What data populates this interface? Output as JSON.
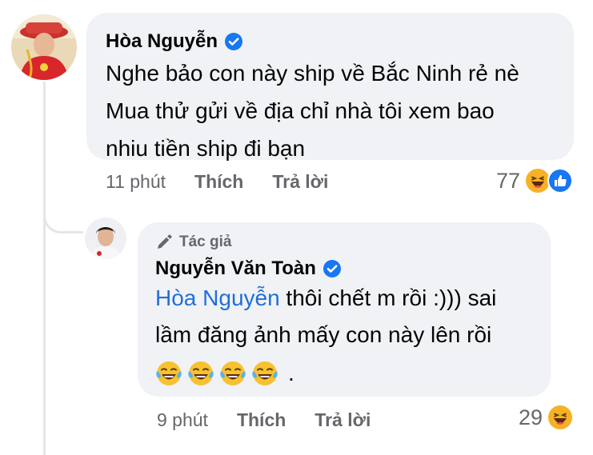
{
  "comment": {
    "author": "Hòa Nguyễn",
    "lines": [
      "Nghe bảo con này ship về Bắc Ninh rẻ nè",
      "Mua thử gửi về địa chỉ nhà tôi xem bao",
      "nhiu tiền ship đi bạn"
    ],
    "time": "11 phút",
    "like_label": "Thích",
    "reply_label": "Trả lời",
    "reaction_count": "77",
    "reaction_icons": [
      "haha-icon",
      "like-icon"
    ]
  },
  "reply": {
    "badge": "Tác giả",
    "author": "Nguyễn Văn Toàn",
    "mention": "Hòa Nguyễn",
    "text_after_mention": " thôi chết m rồi :))) sai",
    "line2": "lầm đăng ảnh mấy con này lên rồi",
    "emojis": [
      "tears-of-joy-icon",
      "tears-of-joy-icon",
      "tears-of-joy-icon",
      "tears-of-joy-icon"
    ],
    "trailing": ".",
    "time": "9 phút",
    "like_label": "Thích",
    "reply_label": "Trả lời",
    "reaction_count": "29",
    "reaction_icons": [
      "haha-icon"
    ]
  },
  "colors": {
    "bubble": "#f0f2f5",
    "mention": "#216fdb",
    "verified": "#1877f2",
    "meta_text": "#65676b"
  }
}
